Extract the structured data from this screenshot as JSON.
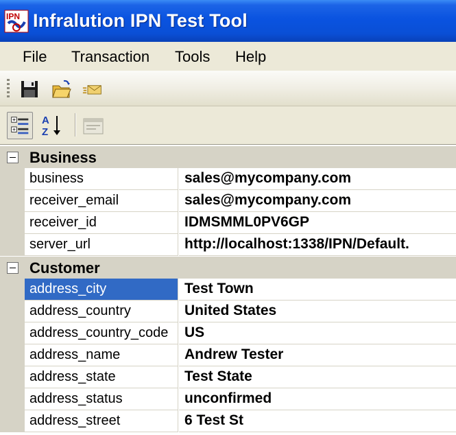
{
  "window": {
    "title": "Infralution IPN Test Tool",
    "icon_name": "ipn-app-icon",
    "icon_text": "IPN"
  },
  "menu": {
    "items": [
      {
        "label": "File"
      },
      {
        "label": "Transaction"
      },
      {
        "label": "Tools"
      },
      {
        "label": "Help"
      }
    ]
  },
  "toolbar": {
    "buttons": [
      {
        "icon": "save-icon"
      },
      {
        "icon": "open-folder-icon"
      },
      {
        "icon": "send-mail-icon"
      }
    ]
  },
  "property_toolbar": {
    "buttons": [
      {
        "icon": "categorized-view-icon",
        "pressed": true
      },
      {
        "icon": "alphabetical-sort-icon",
        "pressed": false
      },
      {
        "icon": "property-pages-icon",
        "enabled": false
      }
    ]
  },
  "grid": {
    "categories": [
      {
        "name": "Business",
        "properties": [
          {
            "name": "business",
            "value": "sales@mycompany.com"
          },
          {
            "name": "receiver_email",
            "value": "sales@mycompany.com"
          },
          {
            "name": "receiver_id",
            "value": "IDMSMML0PV6GP"
          },
          {
            "name": "server_url",
            "value": "http://localhost:1338/IPN/Default."
          }
        ]
      },
      {
        "name": "Customer",
        "properties": [
          {
            "name": "address_city",
            "value": "Test Town",
            "selected": true
          },
          {
            "name": "address_country",
            "value": "United States"
          },
          {
            "name": "address_country_code",
            "value": "US"
          },
          {
            "name": "address_name",
            "value": "Andrew Tester"
          },
          {
            "name": "address_state",
            "value": "Test State"
          },
          {
            "name": "address_status",
            "value": "unconfirmed"
          },
          {
            "name": "address_street",
            "value": "6 Test St"
          }
        ]
      }
    ],
    "colors": {
      "selection": "#316ac5",
      "category_background": "#d6d3c6"
    }
  }
}
